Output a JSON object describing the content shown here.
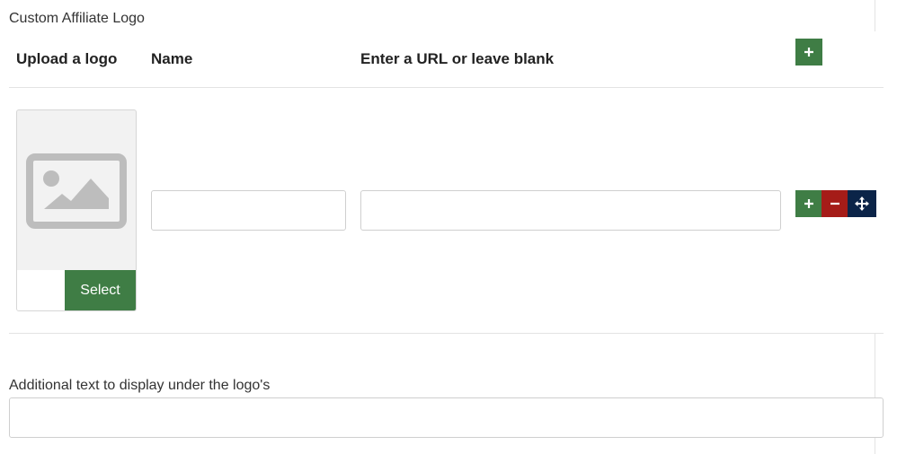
{
  "section_title": "Custom Affiliate Logo",
  "columns": {
    "upload": "Upload a logo",
    "name": "Name",
    "url": "Enter a URL or leave blank"
  },
  "row": {
    "select_label": "Select",
    "name_value": "",
    "url_value": ""
  },
  "additional": {
    "label": "Additional text to display under the logo's",
    "value": ""
  },
  "icons": {
    "add": "plus-icon",
    "remove": "minus-icon",
    "move": "move-arrows-icon",
    "placeholder": "image-placeholder-icon"
  },
  "colors": {
    "green": "#3f7d45",
    "red": "#a51c18",
    "navy": "#0b2448"
  }
}
